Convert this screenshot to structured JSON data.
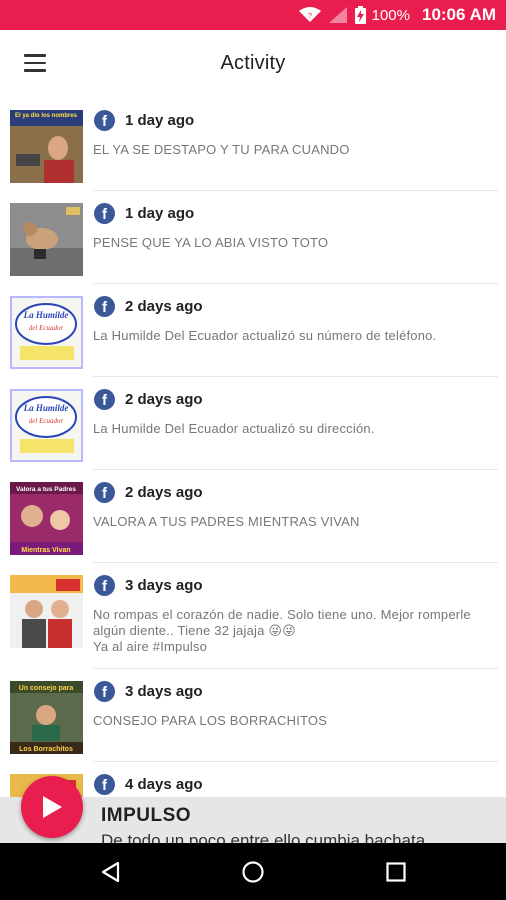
{
  "status_bar": {
    "battery": "100%",
    "time": "10:06 AM",
    "icons": [
      "wifi-icon",
      "signal-icon",
      "battery-charging-icon"
    ]
  },
  "header": {
    "title": "Activity",
    "menu_icon": "hamburger-menu-icon"
  },
  "activity": [
    {
      "time": "1 day ago",
      "text": "EL YA SE DESTAPO Y TU PARA CUANDO",
      "thumb_text_top": "El ya dio los nombres",
      "thumb_text_bottom": ""
    },
    {
      "time": "1 day ago",
      "text": "PENSE QUE YA LO ABIA VISTO TOTO",
      "thumb_text_top": "",
      "thumb_text_bottom": ""
    },
    {
      "time": "2 days ago",
      "text": "La Humilde Del Ecuador actualizó su número de teléfono.",
      "thumb_text_top": "La Humilde",
      "thumb_text_bottom": "del Ecuador"
    },
    {
      "time": "2 days ago",
      "text": "La Humilde Del Ecuador actualizó su dirección.",
      "thumb_text_top": "La Humilde",
      "thumb_text_bottom": "del Ecuador"
    },
    {
      "time": "2 days ago",
      "text": "VALORA A TUS PADRES MIENTRAS VIVAN",
      "thumb_text_top": "Valora a tus Padres",
      "thumb_text_bottom": "Mientras Vivan"
    },
    {
      "time": "3 days ago",
      "text": "No rompas el corazón de nadie. Solo tiene uno. Mejor romperle algún diente.. Tiene  32 jajaja 😜😜\nYa al aire #Impulso",
      "thumb_text_top": "",
      "thumb_text_bottom": ""
    },
    {
      "time": "3 days ago",
      "text": "CONSEJO PARA LOS BORRACHITOS",
      "thumb_text_top": "Un consejo para",
      "thumb_text_bottom": "Los Borrachitos"
    },
    {
      "time": "4 days ago",
      "text": "",
      "thumb_text_top": "",
      "thumb_text_bottom": ""
    }
  ],
  "player": {
    "title": "IMPULSO",
    "subtitle": "De todo un poco entre ello cumbia bachata",
    "play_icon": "play-icon"
  },
  "nav": {
    "icons": [
      "back-icon",
      "home-icon",
      "recents-icon"
    ]
  },
  "colors": {
    "accent": "#e91e4f",
    "facebook": "#3b5998",
    "player_bg": "#e6e6e6"
  }
}
